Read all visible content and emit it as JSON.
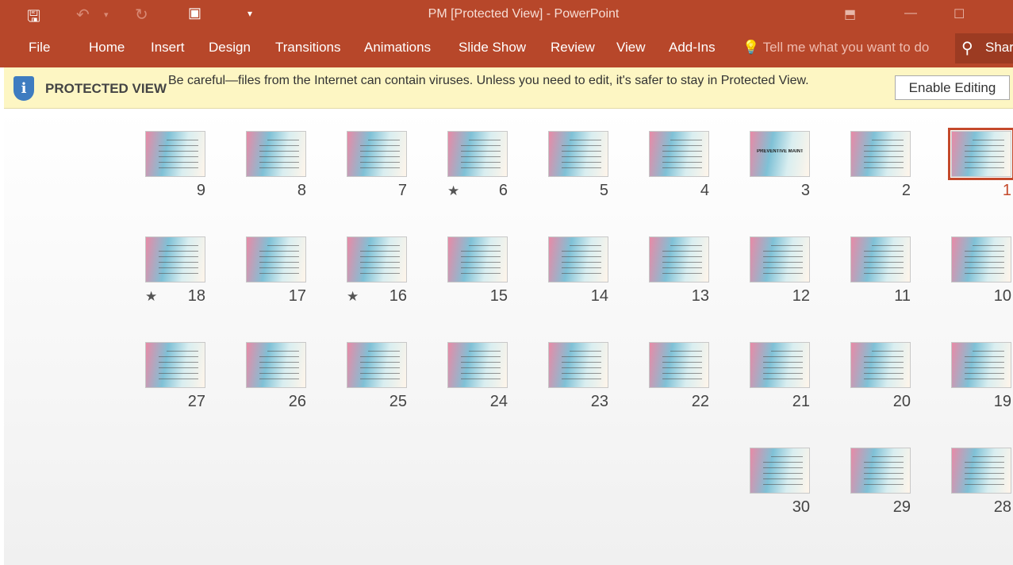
{
  "titlebar": {
    "title": "PM [Protected View] - PowerPoint",
    "icons": [
      "save-icon",
      "undo-icon",
      "redo-icon",
      "present-icon",
      "customize-qat-icon",
      "ribbon-display-icon",
      "minimize-icon",
      "maximize-icon"
    ]
  },
  "ribbon": {
    "tabs": [
      "File",
      "Home",
      "Insert",
      "Design",
      "Transitions",
      "Animations",
      "Slide Show",
      "Review",
      "View",
      "Add-Ins"
    ],
    "tell_me": "Tell me what you want to do",
    "share": "Share"
  },
  "protected_view": {
    "label": "PROTECTED VIEW",
    "message": "Be careful—files from the Internet can contain viruses. Unless you need to edit, it's safer to stay in Protected View.",
    "button": "Enable Editing"
  },
  "slides": [
    {
      "n": "1",
      "selected": true
    },
    {
      "n": "2"
    },
    {
      "n": "3",
      "text": "PREVENTIVE MAINTENANCE"
    },
    {
      "n": "4"
    },
    {
      "n": "5"
    },
    {
      "n": "6",
      "animated": true
    },
    {
      "n": "7"
    },
    {
      "n": "8"
    },
    {
      "n": "9"
    },
    {
      "n": "10"
    },
    {
      "n": "11"
    },
    {
      "n": "12"
    },
    {
      "n": "13"
    },
    {
      "n": "14"
    },
    {
      "n": "15"
    },
    {
      "n": "16",
      "animated": true
    },
    {
      "n": "17"
    },
    {
      "n": "18",
      "animated": true
    },
    {
      "n": "19"
    },
    {
      "n": "20"
    },
    {
      "n": "21"
    },
    {
      "n": "22"
    },
    {
      "n": "23"
    },
    {
      "n": "24"
    },
    {
      "n": "25"
    },
    {
      "n": "26"
    },
    {
      "n": "27"
    },
    {
      "n": "28"
    },
    {
      "n": "29"
    },
    {
      "n": "30"
    }
  ],
  "colors": {
    "accent": "#b7472a",
    "selected": "#c4492b",
    "banner": "#fdf6c3"
  }
}
